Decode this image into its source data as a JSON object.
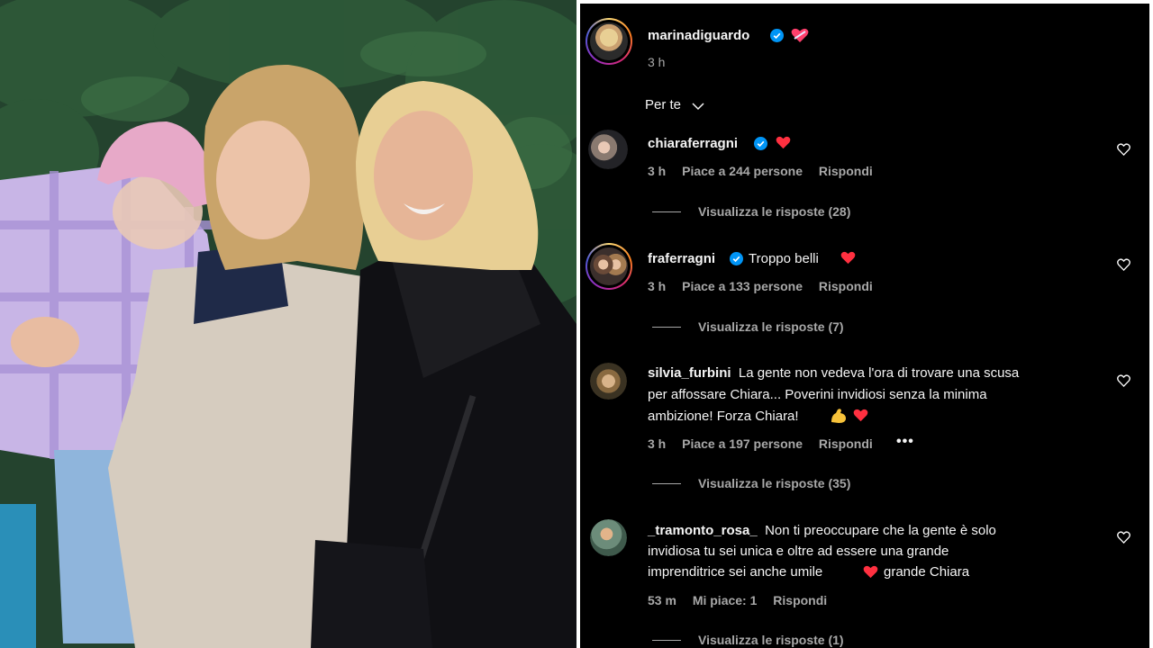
{
  "post": {
    "author": "marinadiguardo",
    "time": "3 h",
    "sort_label": "Per te"
  },
  "comments": [
    {
      "username": "chiaraferragni",
      "text": "",
      "time": "3 h",
      "likes": "Piace a 244 persone",
      "reply": "Rispondi",
      "view_replies": "Visualizza le risposte (28)"
    },
    {
      "username": "fraferragni",
      "text": "Troppo belli",
      "time": "3 h",
      "likes": "Piace a 133 persone",
      "reply": "Rispondi",
      "view_replies": "Visualizza le risposte (7)"
    },
    {
      "username": "silvia_furbini",
      "text_line1": "La gente non vedeva l'ora di trovare una scusa",
      "text_line2": "per affossare Chiara... Poverini invidiosi senza la minima",
      "text_line3": "ambizione! Forza Chiara!",
      "time": "3 h",
      "likes": "Piace a 197 persone",
      "reply": "Rispondi",
      "more": "•••",
      "view_replies": "Visualizza le risposte (35)"
    },
    {
      "username": "_tramonto_rosa_",
      "text_line1": "Non ti preoccupare che la gente è solo",
      "text_line2": "invidiosa tu sei unica e oltre ad essere una grande",
      "text_line3a": "imprenditrice sei anche umile",
      "text_line3b": "grande Chiara",
      "time": "53 m",
      "likes": "Mi piace: 1",
      "reply": "Rispondi",
      "view_replies": "Visualizza le risposte (1)"
    }
  ],
  "colors": {
    "background": "#000000",
    "text_primary": "#f5f5f5",
    "text_secondary": "#a8a8a8",
    "verified_blue": "#0095f6",
    "heart_red": "#ff3040"
  },
  "icons": {
    "verified": "verified-badge-icon",
    "heart": "red-heart-emoji",
    "like": "heart-outline-icon",
    "chevron": "chevron-down-icon",
    "flex": "flexed-biceps-emoji"
  }
}
